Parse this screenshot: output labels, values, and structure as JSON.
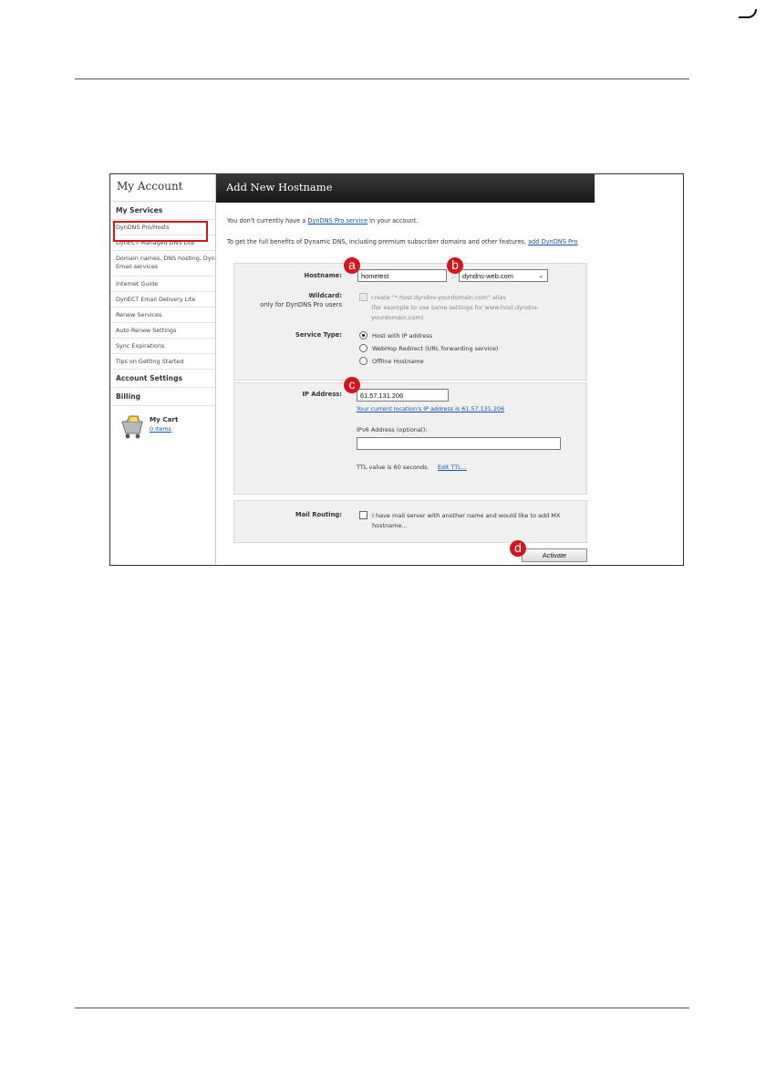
{
  "sidebar": {
    "title": "My Account",
    "sections": {
      "my_services": "My Services",
      "account_settings": "Account Settings",
      "billing": "Billing"
    },
    "items": [
      "DynDNS Pro/Hosts",
      "DynECT Managed DNS Lite",
      "Domain names, DNS hosting, Dyn Email services",
      "Internet Guide",
      "DynECT Email Delivery Lite",
      "Renew Services",
      "Auto Renew Settings",
      "Sync Expirations",
      "Tips on Getting Started"
    ],
    "cart": {
      "label": "My Cart",
      "items": "0 items"
    }
  },
  "header": {
    "title": "Add New Hostname"
  },
  "intro": {
    "line1_a": "You don't currently have a ",
    "line1_link": "DynDNS Pro service",
    "line1_b": " in your account.",
    "line2_a": "To get the full benefits of Dynamic DNS, including premium subscriber domains and other features, ",
    "line2_link": "add DynDNS Pro"
  },
  "form": {
    "hostname_label": "Hostname:",
    "hostname_value": "hometest",
    "dot": ".",
    "domain_value": "dyndns-web.com",
    "wildcard_label": "Wildcard:",
    "wildcard_sub": "only for DynDNS Pro users",
    "wildcard_text1": "create \"*.host.dyndns-yourdomain.com\" alias",
    "wildcard_text2": "(for example to use same settings for www.host.dyndns-",
    "wildcard_text3": "yourdomain.com)",
    "service_type_label": "Service Type:",
    "service_options": [
      "Host with IP address",
      "WebHop Redirect (URL forwarding service)",
      "Offline Hostname"
    ],
    "ip_label": "IP Address:",
    "ip_value": "61.57.131.206",
    "ip_current_link": "Your current location's IP address is 61.57.131.206",
    "ipv6_label": "IPv6 Address (optional):",
    "ipv6_value": "",
    "ttl_text": "TTL value is 60 seconds.",
    "ttl_link": "Edit TTL...",
    "mail_label": "Mail Routing:",
    "mail_text1": "I have mail server with another name and would like to add MX",
    "mail_text2": "hostname...",
    "activate_label": "Activate"
  },
  "badges": {
    "a": "a",
    "b": "b",
    "c": "c",
    "d": "d"
  },
  "colors": {
    "highlight": "#d4161c",
    "link": "#1155aa",
    "header_bg": "#1e1e1e"
  }
}
